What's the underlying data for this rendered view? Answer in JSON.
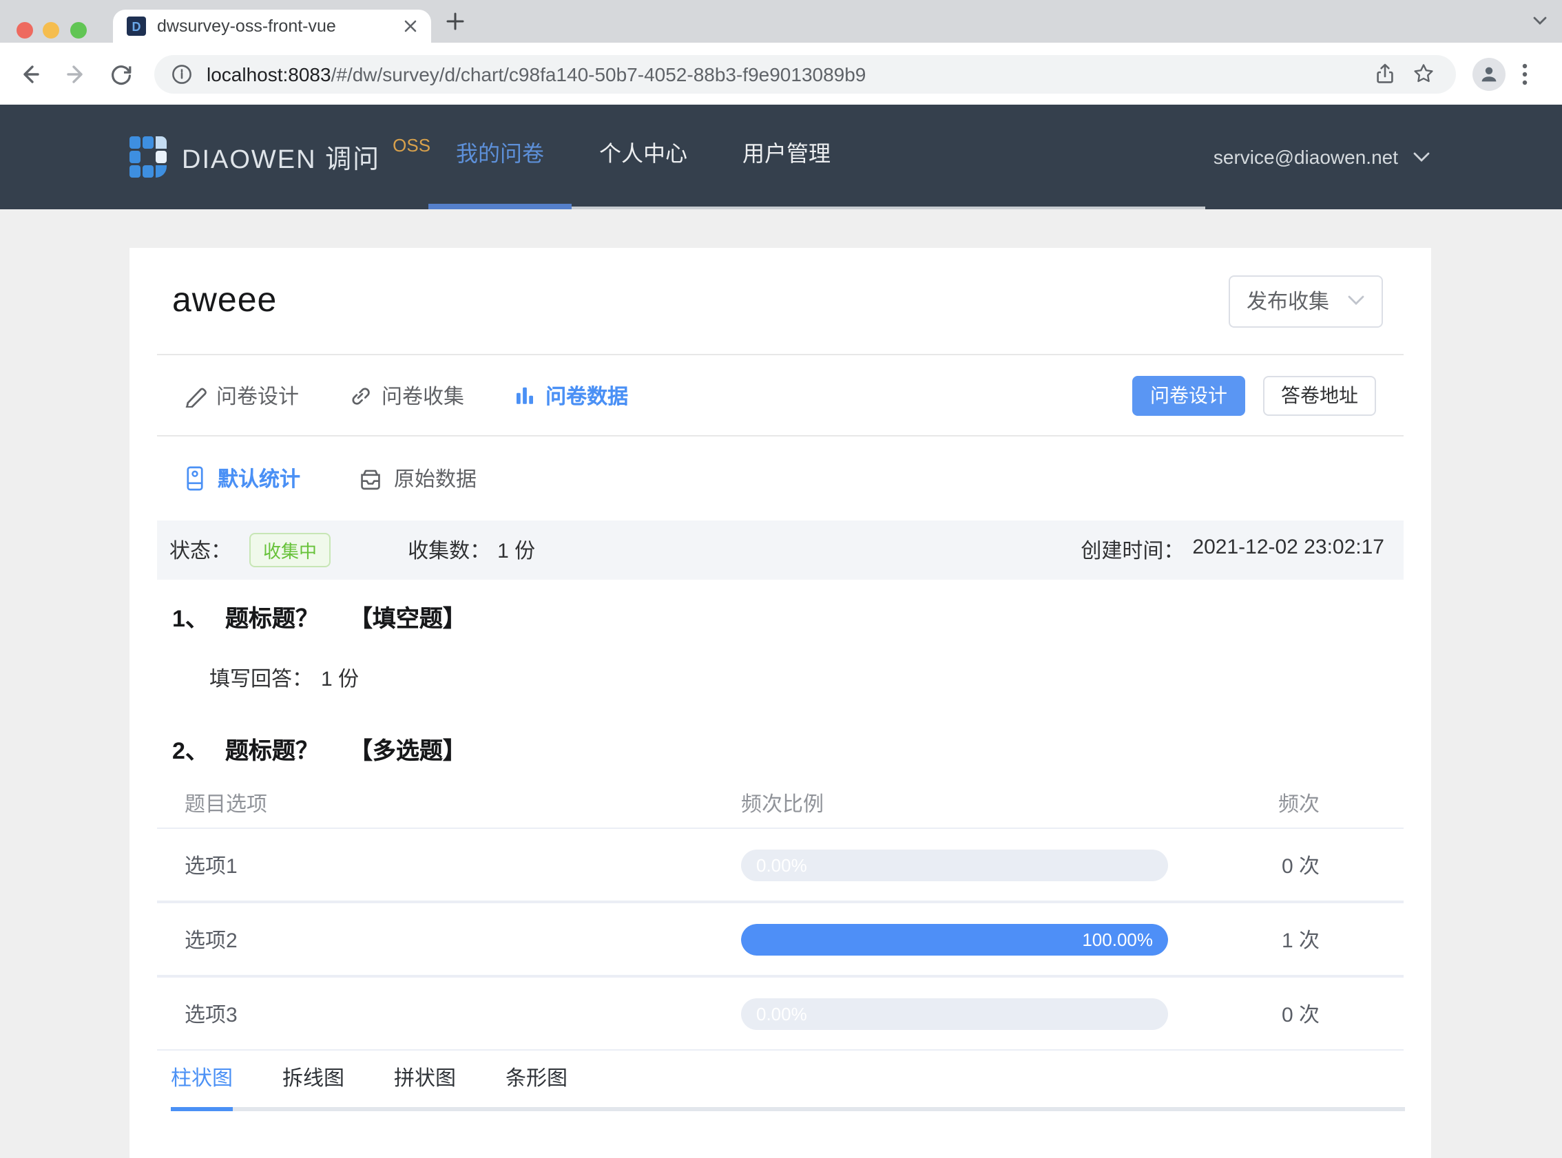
{
  "browser": {
    "tab_title": "dwsurvey-oss-front-vue",
    "url": {
      "host": "localhost:8083",
      "path": "/#/dw/survey/d/chart/c98fa140-50b7-4052-88b3-f9e9013089b9"
    }
  },
  "header": {
    "brand": "DIAOWEN 调问",
    "brand_suffix": "OSS",
    "nav": [
      {
        "label": "我的问卷",
        "active": true
      },
      {
        "label": "个人中心",
        "active": false
      },
      {
        "label": "用户管理",
        "active": false
      }
    ],
    "account_email": "service@diaowen.net"
  },
  "survey": {
    "title": "aweee",
    "publish_select": "发布收集"
  },
  "doc_tabs": {
    "design": "问卷设计",
    "collect": "问卷收集",
    "data": "问卷数据"
  },
  "actions": {
    "design_button": "问卷设计",
    "answer_url_button": "答卷地址"
  },
  "stats_tabs": {
    "default": "默认统计",
    "raw": "原始数据"
  },
  "status_bar": {
    "status_label": "状态：",
    "status_badge": "收集中",
    "count_label": "收集数：",
    "count_value": "1 份",
    "created_label": "创建时间：",
    "created_value": "2021-12-02 23:02:17"
  },
  "question1": {
    "index": "1、",
    "title": "题标题？",
    "type": "【填空题】",
    "answer_label": "填写回答：",
    "answer_value": "1 份"
  },
  "question2": {
    "index": "2、",
    "title": "题标题？",
    "type": "【多选题】",
    "table": {
      "headers": [
        "题目选项",
        "频次比例",
        "频次"
      ],
      "rows": [
        {
          "option": "选项1",
          "percent_label": "0.00%",
          "percent": 0,
          "count": "0 次"
        },
        {
          "option": "选项2",
          "percent_label": "100.00%",
          "percent": 100,
          "count": "1 次"
        },
        {
          "option": "选项3",
          "percent_label": "0.00%",
          "percent": 0,
          "count": "0 次"
        }
      ]
    }
  },
  "chart_tabs": [
    {
      "label": "柱状图",
      "active": true
    },
    {
      "label": "拆线图",
      "active": false
    },
    {
      "label": "拼状图",
      "active": false
    },
    {
      "label": "条形图",
      "active": false
    }
  ],
  "colors": {
    "primary": "#4a90f5",
    "bar_fill": "#4e8ff7",
    "bar_track": "#e9edf4",
    "badge_green": "#67c23a",
    "header_bg": "#35404d",
    "nav_active": "#5d90d9"
  }
}
